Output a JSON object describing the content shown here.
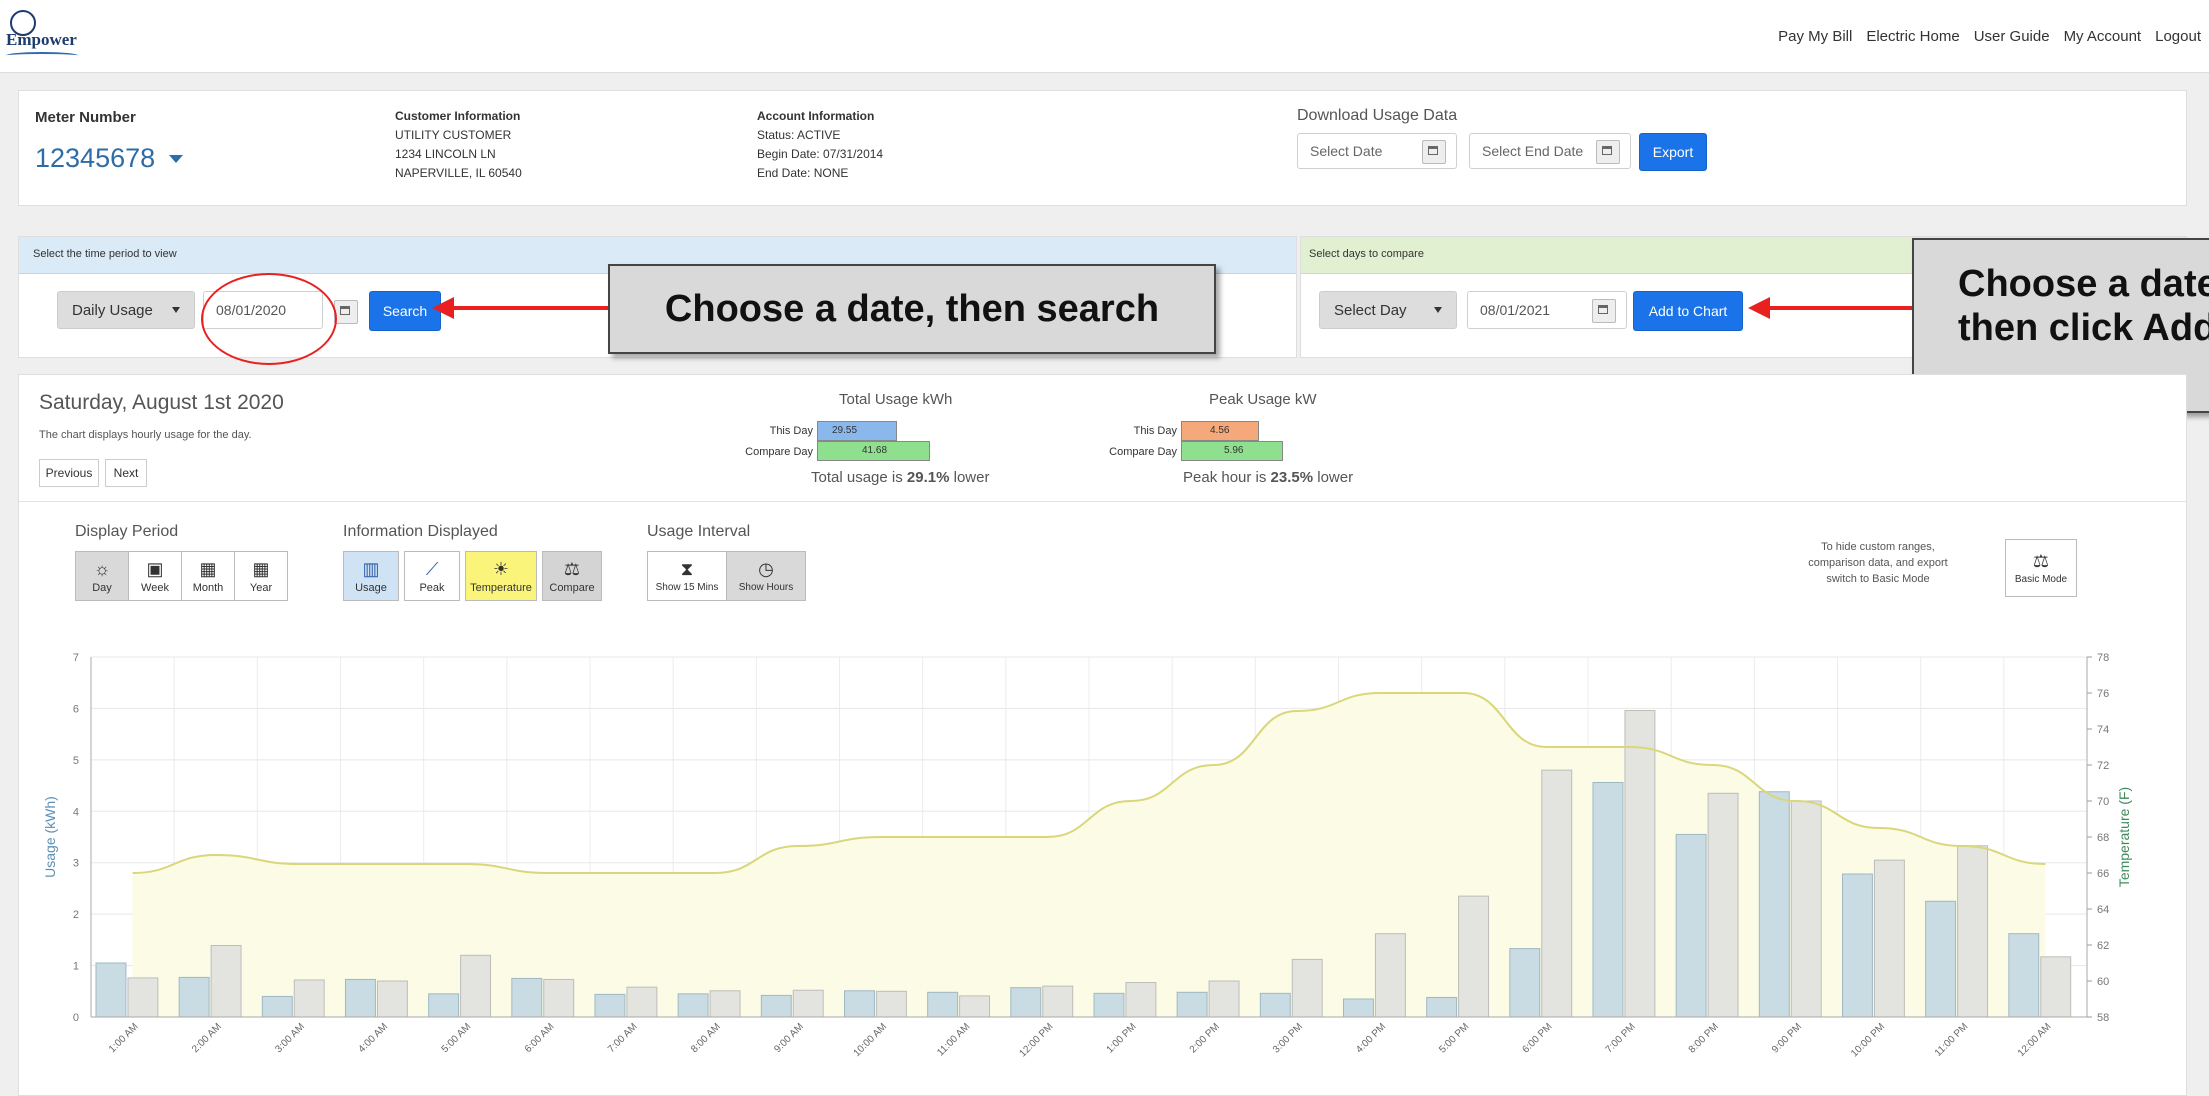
{
  "header": {
    "logo_text": "Empower",
    "nav": [
      "Pay My Bill",
      "Electric Home",
      "User Guide",
      "My Account",
      "Logout"
    ]
  },
  "meter": {
    "label": "Meter Number",
    "number": "12345678"
  },
  "customer": {
    "title": "Customer Information",
    "lines": [
      "UTILITY CUSTOMER",
      "1234 LINCOLN LN",
      "NAPERVILLE, IL 60540"
    ]
  },
  "account": {
    "title": "Account Information",
    "lines": [
      "Status: ACTIVE",
      "Begin Date: 07/31/2014",
      "End Date: NONE"
    ]
  },
  "download": {
    "title": "Download Usage Data",
    "start_placeholder": "Select Date",
    "end_placeholder": "Select End Date",
    "export_label": "Export"
  },
  "period_select": {
    "header": "Select the time period to view",
    "mode": "Daily Usage",
    "date": "08/01/2020",
    "search_label": "Search"
  },
  "compare_select": {
    "header": "Select days to compare",
    "mode": "Select Day",
    "date": "08/01/2021",
    "add_label": "Add to Chart"
  },
  "callouts": {
    "left": "Choose a date, then search",
    "right": "Choose a date to compare, then click Add to Chart"
  },
  "summary": {
    "date_title": "Saturday, August 1st 2020",
    "subtitle": "The chart displays hourly usage for the day.",
    "prev_label": "Previous",
    "next_label": "Next",
    "total": {
      "title": "Total Usage kWh",
      "this_day_label": "This Day",
      "compare_day_label": "Compare Day",
      "this_day": "29.55",
      "compare_day": "41.68",
      "this_day_value": 29.55,
      "compare_day_value": 41.68,
      "note_prefix": "Total usage is ",
      "note_bold": "29.1%",
      "note_suffix": " lower"
    },
    "peak": {
      "title": "Peak Usage kW",
      "this_day_label": "This Day",
      "compare_day_label": "Compare Day",
      "this_day": "4.56",
      "compare_day": "5.96",
      "this_day_value": 4.56,
      "compare_day_value": 5.96,
      "note_prefix": "Peak hour is ",
      "note_bold": "23.5%",
      "note_suffix": " lower"
    }
  },
  "controls": {
    "display_period": {
      "title": "Display Period",
      "buttons": [
        "Day",
        "Week",
        "Month",
        "Year"
      ],
      "icons": [
        "sun-icon",
        "calendar-week-icon",
        "calendar-month-icon",
        "calendar-year-icon"
      ]
    },
    "info_displayed": {
      "title": "Information Displayed",
      "buttons": [
        "Usage",
        "Peak",
        "Temperature",
        "Compare"
      ],
      "icons": [
        "bar-chart-icon",
        "line-chart-icon",
        "weather-icon",
        "scale-icon"
      ]
    },
    "usage_interval": {
      "title": "Usage Interval",
      "buttons": [
        "Show 15 Mins",
        "Show Hours"
      ],
      "icons": [
        "hourglass-icon",
        "clock-icon"
      ]
    },
    "basic_mode": {
      "hint_lines": [
        "To hide custom ranges,",
        "comparison data, and export",
        "switch to Basic Mode"
      ],
      "label": "Basic Mode"
    }
  },
  "colors": {
    "accent": "#1a73e8",
    "usage_bar": "#c9dbe3",
    "compare_bar": "#e3e3e0",
    "temperature_line": "#d9d77a",
    "temperature_fill": "#fbfbe6",
    "axis_blue": "#5b8fb5",
    "axis_green": "#3f8a5a"
  },
  "chart_data": {
    "type": "bar",
    "categories": [
      "1:00 AM",
      "2:00 AM",
      "3:00 AM",
      "4:00 AM",
      "5:00 AM",
      "6:00 AM",
      "7:00 AM",
      "8:00 AM",
      "9:00 AM",
      "10:00 AM",
      "11:00 AM",
      "12:00 PM",
      "1:00 PM",
      "2:00 PM",
      "3:00 PM",
      "4:00 PM",
      "5:00 PM",
      "6:00 PM",
      "7:00 PM",
      "8:00 PM",
      "9:00 PM",
      "10:00 PM",
      "11:00 PM",
      "12:00 AM"
    ],
    "series": [
      {
        "values": [
          1.05,
          0.77,
          0.4,
          0.73,
          0.45,
          0.75,
          0.44,
          0.45,
          0.42,
          0.51,
          0.48,
          0.57,
          0.46,
          0.48,
          0.46,
          0.35,
          0.38,
          1.33,
          4.56,
          3.55,
          4.38,
          2.78,
          2.25,
          1.62
        ]
      },
      {
        "values": [
          0.76,
          1.39,
          0.72,
          0.7,
          1.2,
          0.73,
          0.58,
          0.51,
          0.52,
          0.5,
          0.41,
          0.6,
          0.67,
          0.7,
          1.12,
          1.62,
          2.35,
          4.8,
          5.96,
          4.35,
          4.2,
          3.05,
          3.33,
          1.17
        ]
      },
      {
        "values": [
          66,
          67,
          66.5,
          66.5,
          66.5,
          66,
          66,
          66,
          67.5,
          68,
          68,
          68,
          70,
          72,
          75,
          76,
          76,
          73,
          73,
          72,
          70,
          68.5,
          67.5,
          66.5
        ]
      }
    ],
    "ylabel": "Usage (kWh)",
    "y2label": "Temperature (F)",
    "ylim": [
      0,
      7
    ],
    "y2lim": [
      58,
      78
    ],
    "yticks": [
      "0",
      "1",
      "2",
      "3",
      "4",
      "5",
      "6",
      "7"
    ],
    "y2ticks": [
      "58",
      "60",
      "62",
      "64",
      "66",
      "68",
      "70",
      "72",
      "74",
      "76",
      "78"
    ],
    "grid": true
  }
}
